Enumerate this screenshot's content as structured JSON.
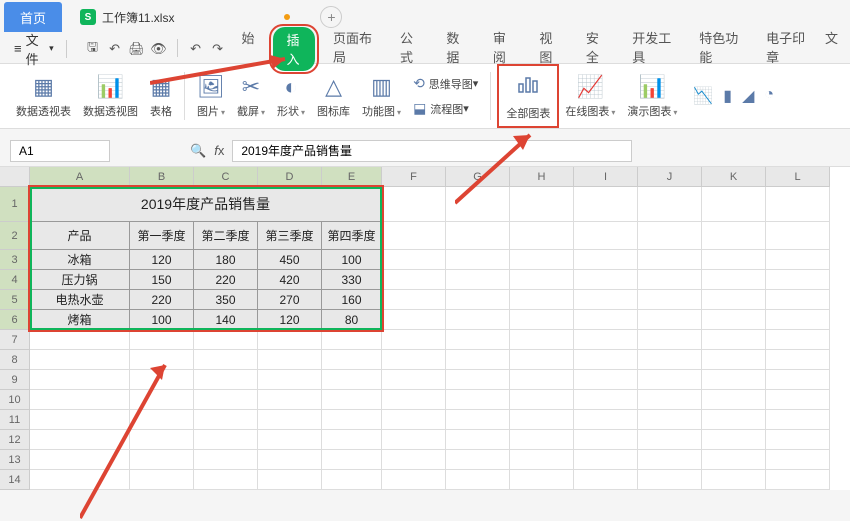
{
  "titlebar": {
    "home": "首页",
    "filename": "工作簿11.xlsx"
  },
  "menubar": {
    "file_label": "文件"
  },
  "ribbon_tabs": {
    "start": "始",
    "insert": "插入",
    "page_layout": "页面布局",
    "formula": "公式",
    "data": "数据",
    "review": "审阅",
    "view": "视图",
    "security": "安全",
    "dev_tools": "开发工具",
    "features": "特色功能",
    "esignature": "电子印章",
    "more": "文"
  },
  "ribbon": {
    "pivot_table": "数据透视表",
    "pivot_chart": "数据透视图",
    "table": "表格",
    "picture": "图片",
    "screenshot": "截屏",
    "shape": "形状",
    "icon_lib": "图标库",
    "function_chart": "功能图",
    "mind_map": "思维导图",
    "flowchart": "流程图",
    "all_charts": "全部图表",
    "online_chart": "在线图表",
    "demo_chart": "演示图表"
  },
  "formulabar": {
    "namebox": "A1",
    "formula": "2019年度产品销售量"
  },
  "columns": [
    "A",
    "B",
    "C",
    "D",
    "E",
    "F",
    "G",
    "H",
    "I",
    "J",
    "K",
    "L"
  ],
  "rows": [
    "1",
    "2",
    "3",
    "4",
    "5",
    "6",
    "7",
    "8",
    "9",
    "10",
    "11",
    "12",
    "13",
    "14"
  ],
  "chart_data": {
    "type": "table",
    "title": "2019年度产品销售量",
    "headers": [
      "产品",
      "第一季度",
      "第二季度",
      "第三季度",
      "第四季度"
    ],
    "rows": [
      {
        "product": "冰箱",
        "q1": 120,
        "q2": 180,
        "q3": 450,
        "q4": 100
      },
      {
        "product": "压力锅",
        "q1": 150,
        "q2": 220,
        "q3": 420,
        "q4": 330
      },
      {
        "product": "电热水壶",
        "q1": 220,
        "q2": 350,
        "q3": 270,
        "q4": 160
      },
      {
        "product": "烤箱",
        "q1": 100,
        "q2": 140,
        "q3": 120,
        "q4": 80
      }
    ]
  }
}
